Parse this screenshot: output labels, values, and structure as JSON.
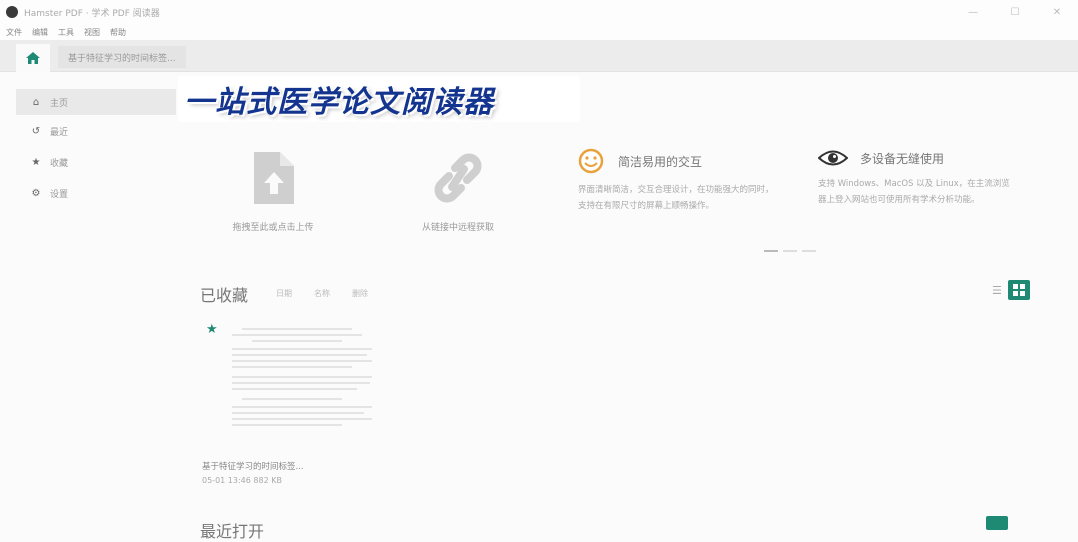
{
  "window": {
    "title": "Hamster PDF · 学术 PDF 阅读器",
    "controls": [
      "—",
      "☐",
      "✕"
    ]
  },
  "menu": [
    "文件",
    "编辑",
    "工具",
    "视图",
    "帮助"
  ],
  "tabs": {
    "home_icon": "home-icon",
    "doc_tab_label": "基于特征学习的时间标签..."
  },
  "sidebar": {
    "items": [
      {
        "label": "主页",
        "icon": "home-icon",
        "active": true
      },
      {
        "label": "最近",
        "icon": "history-icon",
        "active": false
      },
      {
        "label": "收藏",
        "icon": "star-icon",
        "active": false
      },
      {
        "label": "设置",
        "icon": "gear-icon",
        "active": false
      }
    ]
  },
  "banner": {
    "text": "一站式医学论文阅读器"
  },
  "features": {
    "upload_caption": "拖拽至此或点击上传",
    "link_caption": "从链接中远程获取",
    "simple_title": "简洁易用的交互",
    "simple_desc": "界面清晰简洁，交互合理设计，在功能强大的同时，支持在有限尺寸的屏幕上顺畅操作。",
    "multi_title": "多设备无缝使用",
    "multi_desc": "支持 Windows、MacOS 以及 Linux，在主流浏览器上登入网站也可使用所有学术分析功能。"
  },
  "favorites": {
    "title": "已收藏",
    "filters": [
      "日期",
      "名称",
      "删除"
    ],
    "list_icon": "list-view-icon",
    "grid_icon": "grid-view-icon",
    "items": [
      {
        "name": "基于特征学习的时间标签...",
        "meta": "05-01 13:46  882 KB"
      }
    ]
  },
  "recent": {
    "title": "最近打开"
  },
  "colors": {
    "accent": "#1e8a74",
    "banner_text": "#14358f"
  }
}
